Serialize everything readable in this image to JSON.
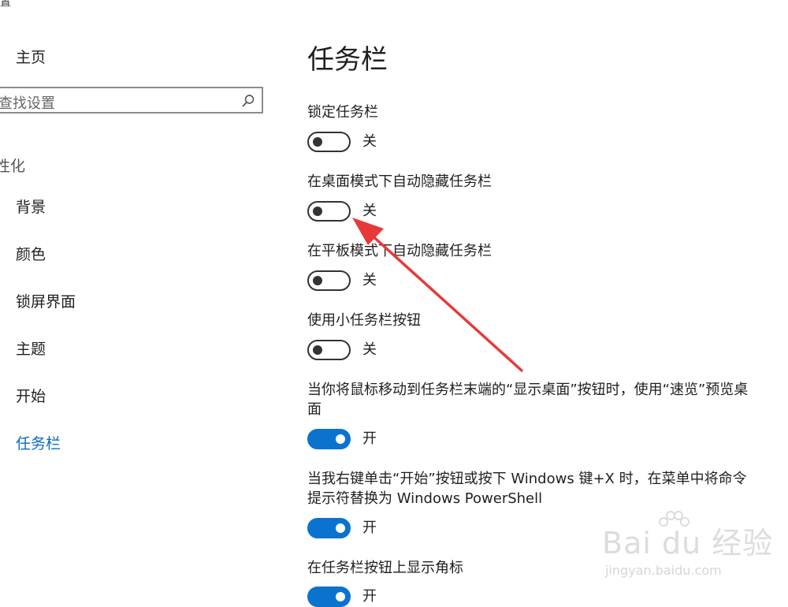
{
  "window": {
    "corner_glyph": "置"
  },
  "sidebar": {
    "home": "主页",
    "search_placeholder": "查找设置",
    "section_title": "性化",
    "items": [
      {
        "label": "背景"
      },
      {
        "label": "颜色"
      },
      {
        "label": "锁屏界面"
      },
      {
        "label": "主题"
      },
      {
        "label": "开始"
      },
      {
        "label": "任务栏",
        "active": true
      }
    ]
  },
  "main": {
    "title": "任务栏",
    "settings": [
      {
        "label": "锁定任务栏",
        "state": "关",
        "on": false
      },
      {
        "label": "在桌面模式下自动隐藏任务栏",
        "state": "关",
        "on": false
      },
      {
        "label": "在平板模式下自动隐藏任务栏",
        "state": "关",
        "on": false
      },
      {
        "label": "使用小任务栏按钮",
        "state": "关",
        "on": false
      },
      {
        "label": "当你将鼠标移动到任务栏末端的“显示桌面”按钮时，使用“速览”预览桌面",
        "state": "开",
        "on": true
      },
      {
        "label": "当我右键单击“开始”按钮或按下 Windows 键+X 时，在菜单中将命令提示符替换为 Windows PowerShell",
        "state": "开",
        "on": true
      },
      {
        "label": "在任务栏按钮上显示角标",
        "state": "开",
        "on": true
      }
    ]
  },
  "colors": {
    "accent": "#0a73d0",
    "active_nav": "#0a6bbf",
    "annotation_arrow": "#e8393a"
  },
  "watermark": {
    "brand": "Bai du 经验",
    "url": "jingyan.baidu.com"
  }
}
